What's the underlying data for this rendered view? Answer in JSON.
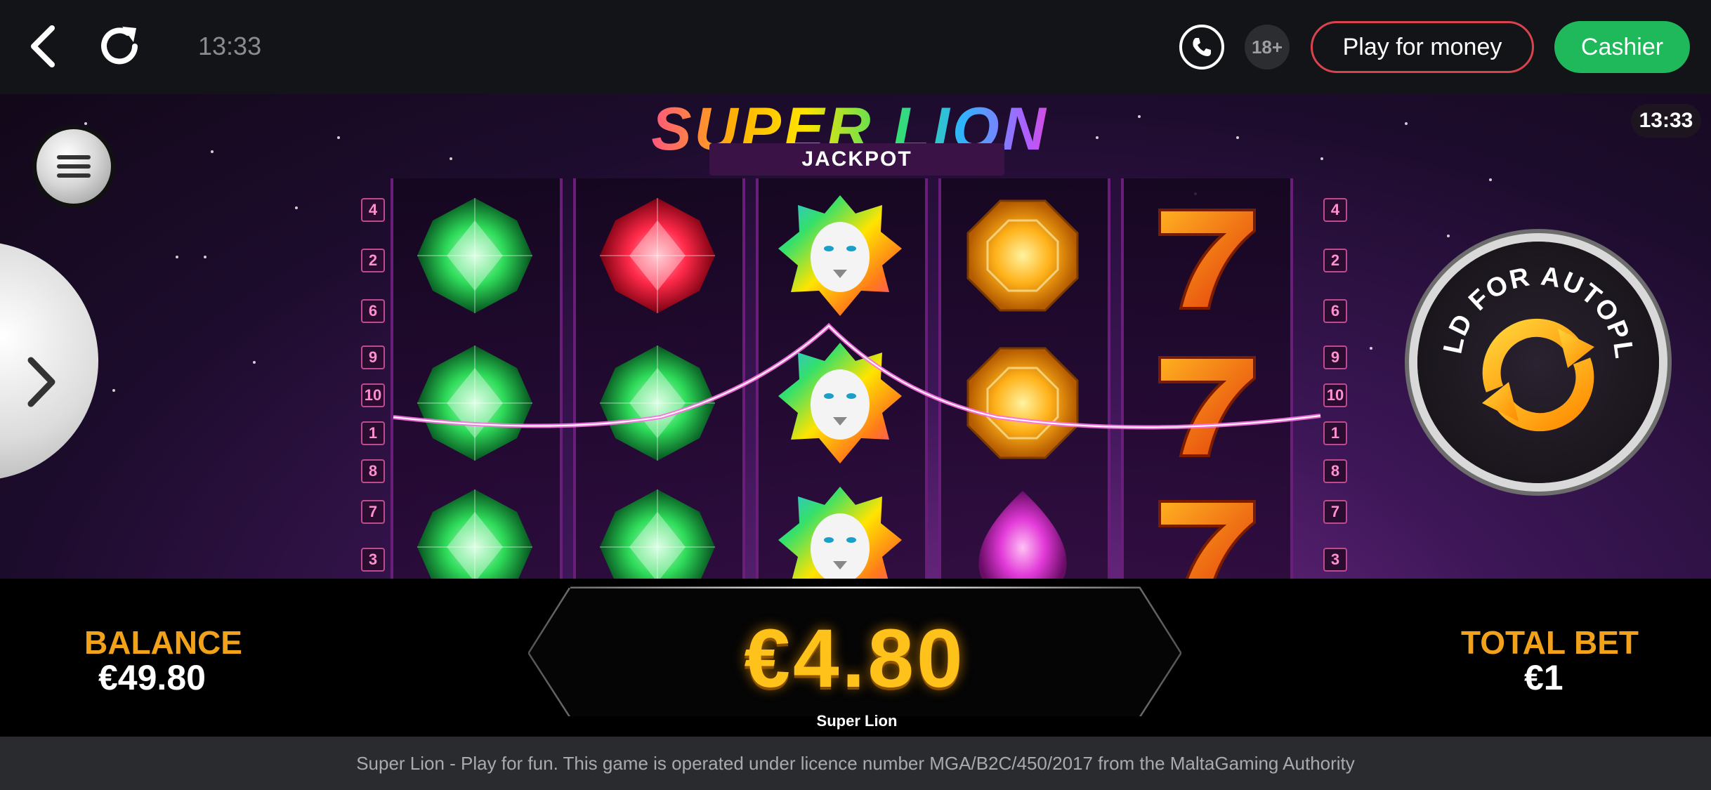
{
  "topbar": {
    "time": "13:33",
    "age_badge": "18+",
    "play_for_money": "Play for money",
    "cashier": "Cashier"
  },
  "game": {
    "logo_title": "SUPER LION",
    "logo_subtitle": "JACKPOT",
    "in_game_time": "13:33",
    "autoplay_label": "HOLD FOR AUTOPLAY",
    "left_line_numbers": [
      "4",
      "2",
      "6",
      "9",
      "10",
      "1",
      "8",
      "7",
      "3"
    ],
    "right_line_numbers": [
      "4",
      "2",
      "6",
      "9",
      "10",
      "1",
      "8",
      "7",
      "3"
    ],
    "reels": [
      [
        "green-gem",
        "green-gem",
        "green-gem"
      ],
      [
        "red-gem",
        "green-gem",
        "green-gem"
      ],
      [
        "rainbow-lion",
        "rainbow-lion",
        "rainbow-lion"
      ],
      [
        "orange-gem",
        "orange-gem",
        "purple-gem"
      ],
      [
        "seven",
        "seven",
        "seven"
      ]
    ],
    "colors": {
      "green-gem": "#2fdc5a",
      "red-gem": "#ff2a4a",
      "orange-gem": "#ffb21a",
      "purple-gem": "#e23ad8",
      "seven": "#ff6a1a"
    }
  },
  "bottom": {
    "balance_label": "BALANCE",
    "balance_value": "€49.80",
    "win_value": "€4.80",
    "total_bet_label": "TOTAL BET",
    "total_bet_value": "€1",
    "game_name": "Super Lion"
  },
  "footer": {
    "text": "Super Lion - Play for fun. This game is operated under licence number MGA/B2C/450/2017 from the MaltaGaming Authority"
  }
}
